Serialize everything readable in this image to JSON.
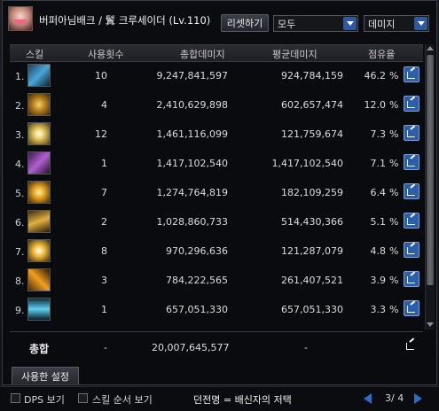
{
  "character": {
    "title": "버퍼아님배크 / 鬒 크루세이더 (Lv.110)"
  },
  "toolbar": {
    "reset_label": "리셋하기",
    "filter_value": "모두",
    "metric_value": "데미지"
  },
  "table": {
    "headers": [
      "스킬",
      "사용횟수",
      "총합데미지",
      "평균데미지",
      "점유율"
    ],
    "percent_symbol": "%",
    "rows": [
      {
        "rank": "1.",
        "count": "10",
        "total": "9,247,841,597",
        "avg": "924,784,159",
        "share": "46.2"
      },
      {
        "rank": "2.",
        "count": "4",
        "total": "2,410,629,898",
        "avg": "602,657,474",
        "share": "12.0"
      },
      {
        "rank": "3.",
        "count": "12",
        "total": "1,461,116,099",
        "avg": "121,759,674",
        "share": "7.3"
      },
      {
        "rank": "4.",
        "count": "1",
        "total": "1,417,102,540",
        "avg": "1,417,102,540",
        "share": "7.1"
      },
      {
        "rank": "5.",
        "count": "7",
        "total": "1,274,764,819",
        "avg": "182,109,259",
        "share": "6.4"
      },
      {
        "rank": "6.",
        "count": "2",
        "total": "1,028,860,733",
        "avg": "514,430,366",
        "share": "5.1"
      },
      {
        "rank": "7.",
        "count": "8",
        "total": "970,296,636",
        "avg": "121,287,079",
        "share": "4.8"
      },
      {
        "rank": "8.",
        "count": "3",
        "total": "784,222,565",
        "avg": "261,407,521",
        "share": "3.9"
      },
      {
        "rank": "9.",
        "count": "1",
        "total": "657,051,330",
        "avg": "657,051,330",
        "share": "3.3"
      }
    ],
    "total": {
      "label": "총합",
      "count": "-",
      "total": "20,007,645,577",
      "avg": "-"
    }
  },
  "tabs": {
    "used_settings": "사용한 설정"
  },
  "footer": {
    "dps_label": "DPS 보기",
    "order_label": "스킬 순서 보기",
    "dungeon_text": "던전명 = 배신자의 저택",
    "page_text": "3/ 4"
  },
  "colors": {
    "accent": "#2d5ea8",
    "panel": "#0e0f12"
  }
}
